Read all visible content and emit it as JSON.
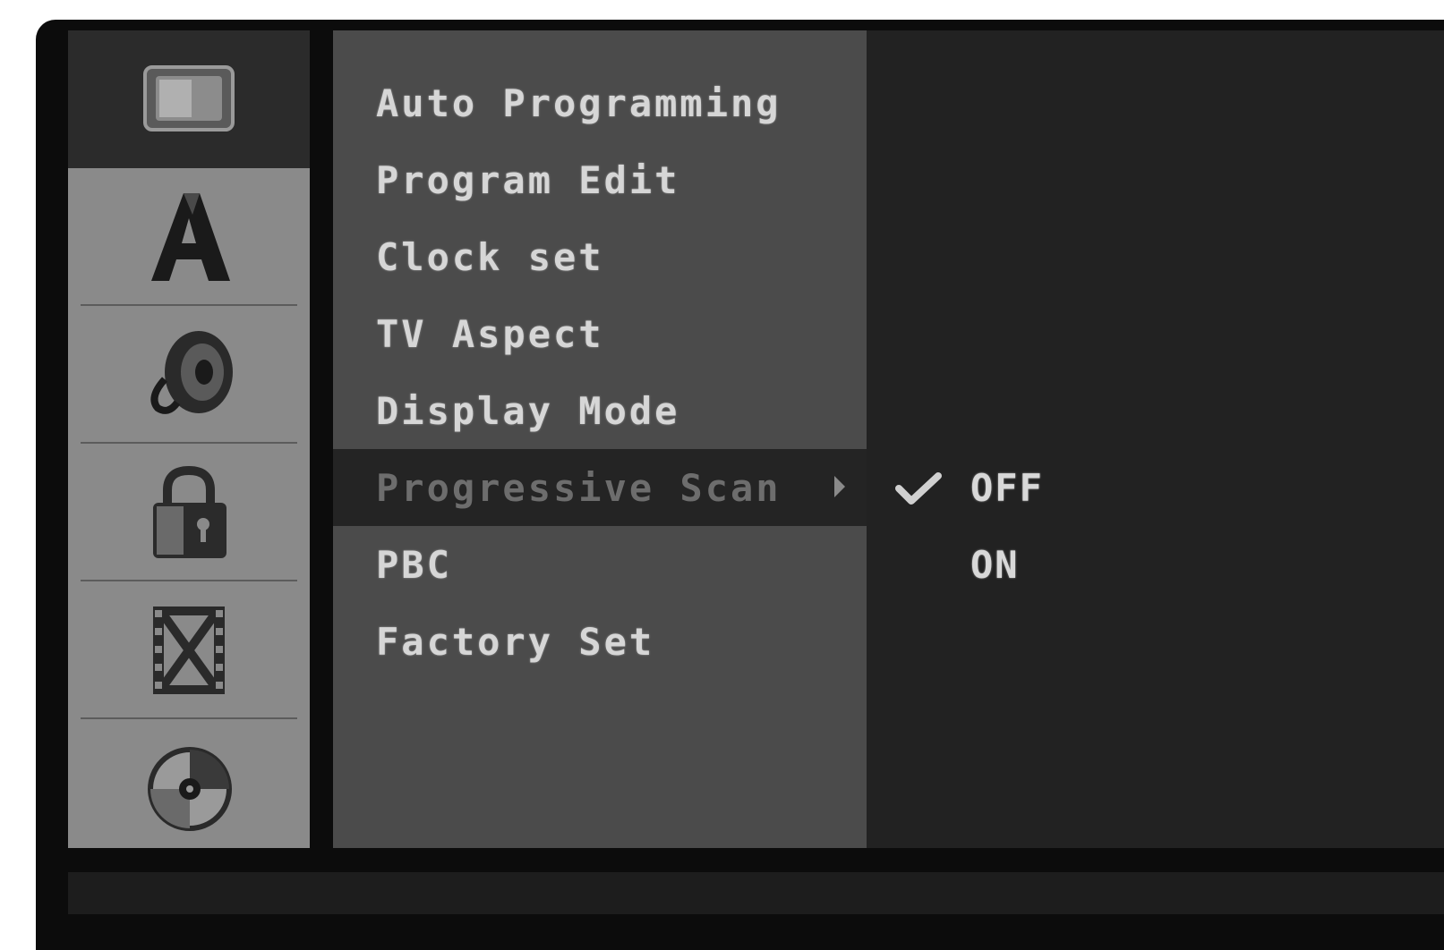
{
  "sidebar": {
    "icons": [
      {
        "name": "tv-screen-icon",
        "active": true
      },
      {
        "name": "language-letter-a-icon",
        "active": false
      },
      {
        "name": "audio-speaker-icon",
        "active": false
      },
      {
        "name": "lock-icon",
        "active": false
      },
      {
        "name": "film-strip-icon",
        "active": false
      },
      {
        "name": "disc-icon",
        "active": false
      }
    ]
  },
  "menu": {
    "items": [
      {
        "label": "Auto Programming"
      },
      {
        "label": "Program Edit"
      },
      {
        "label": "Clock set"
      },
      {
        "label": "TV Aspect"
      },
      {
        "label": "Display Mode"
      },
      {
        "label": "Progressive Scan",
        "selected": true
      },
      {
        "label": "PBC"
      },
      {
        "label": "Factory Set"
      }
    ]
  },
  "submenu": {
    "options": [
      {
        "label": "OFF",
        "checked": true
      },
      {
        "label": "ON",
        "checked": false
      }
    ]
  },
  "colors": {
    "sidebar_bg": "#8a8a8a",
    "menu_bg": "#4b4b4b",
    "submenu_bg": "#222222",
    "text": "#d6d6d6",
    "highlight_bg": "#242424"
  }
}
